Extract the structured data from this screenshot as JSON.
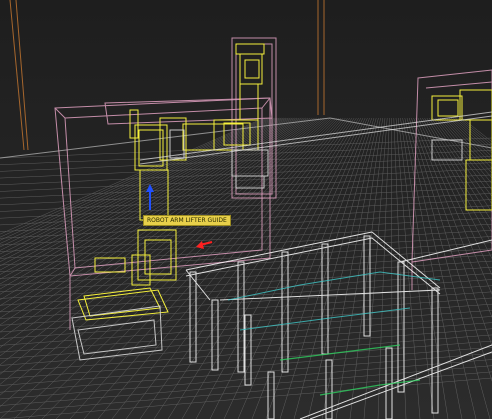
{
  "viewport": {
    "kind": "3D wireframe viewport",
    "background": "#252525",
    "floor_grid_color": "#8a8a8a",
    "selected_color": "#f5f03c",
    "bounding_box_color": "#e0a0c0",
    "structure_color": "#ffffff",
    "accent_cyan": "#40c8c8",
    "accent_green": "#30d060"
  },
  "object_label": {
    "text": "ROBOT ARM LIFTER GUIDE",
    "background": "#e8d04a"
  },
  "gizmo": {
    "y_axis_color": "#2050ff",
    "x_axis_color": "#ff2020",
    "icons": [
      "move-gizmo-icon"
    ]
  }
}
